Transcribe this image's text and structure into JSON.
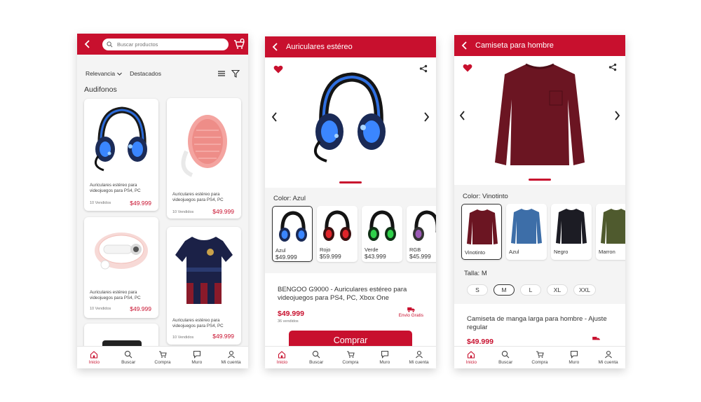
{
  "colors": {
    "brand": "#c8102e",
    "text": "#333333",
    "muted": "#777777"
  },
  "screen1": {
    "search_placeholder": "Buscar productos",
    "sort_label": "Relevancia",
    "filter_label": "Destacados",
    "section_title": "Audifonos",
    "products": [
      {
        "desc": "Auriculares estéreo para videojuegos para PS4, PC",
        "sold": "10 Vendidos",
        "price": "$49.999"
      },
      {
        "desc": "Auriculares estéreo para videojuegos para PS4, PC",
        "sold": "10 Vendidos",
        "price": "$49.999"
      },
      {
        "desc": "Auriculares estéreo para videojuegos para PS4, PC",
        "sold": "10 Vendidos",
        "price": "$49.999"
      },
      {
        "desc": "Auriculares estéreo para videojuegos para PS4, PC",
        "sold": "10 Vendidos",
        "price": "$49.999"
      }
    ]
  },
  "nav": {
    "items": [
      "Inicio",
      "Buscar",
      "Compra",
      "Muro",
      "Mi cuenta"
    ]
  },
  "screen2": {
    "title": "Auriculares estéreo",
    "color_label": "Color: Azul",
    "variants": [
      {
        "name": "Azul",
        "price": "$49.999"
      },
      {
        "name": "Rojo",
        "price": "$59.999"
      },
      {
        "name": "Verde",
        "price": "$43.999"
      },
      {
        "name": "RGB",
        "price": "$45.999"
      }
    ],
    "product_title": "BENGOO G9000 - Auriculares estéreo para videojuegos para PS4, PC, Xbox One",
    "price": "$49.999",
    "sold": "36 vendidos",
    "shipping": "Envio Gratis",
    "buy_label": "Comprar"
  },
  "screen3": {
    "title": "Camiseta para hombre",
    "color_label": "Color: Vinotinto",
    "variants": [
      {
        "name": "Vinotinto"
      },
      {
        "name": "Azul"
      },
      {
        "name": "Negro"
      },
      {
        "name": "Marron"
      }
    ],
    "size_label": "Talla: M",
    "sizes": [
      "S",
      "M",
      "L",
      "XL",
      "XXL"
    ],
    "product_title": "Camiseta de manga larga para hombre - Ajuste regular",
    "price": "$49.999"
  }
}
